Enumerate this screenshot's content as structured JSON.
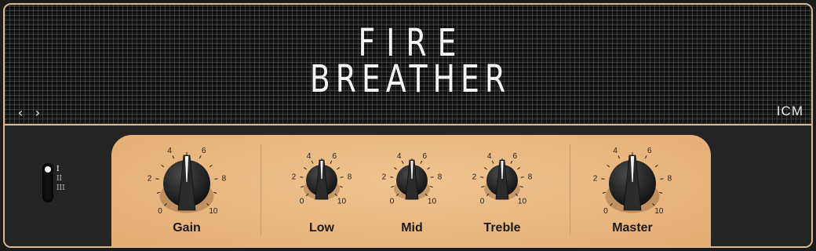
{
  "header": {
    "title_line1": "FIRE",
    "title_line2": "BREATHER",
    "nav_prev": "‹",
    "nav_next": "›",
    "brand": "ICM"
  },
  "switch": {
    "positions": [
      "I",
      "II",
      "III"
    ],
    "selected": "I"
  },
  "knobs": [
    {
      "label": "Gain",
      "value": 5,
      "scale": [
        "0",
        "2",
        "4",
        "6",
        "8",
        "10"
      ]
    },
    {
      "label": "Low",
      "value": 5,
      "scale": [
        "0",
        "2",
        "4",
        "6",
        "8",
        "10"
      ]
    },
    {
      "label": "Mid",
      "value": 5,
      "scale": [
        "0",
        "2",
        "4",
        "6",
        "8",
        "10"
      ]
    },
    {
      "label": "Treble",
      "value": 5,
      "scale": [
        "0",
        "2",
        "4",
        "6",
        "8",
        "10"
      ]
    },
    {
      "label": "Master",
      "value": 5,
      "scale": [
        "0",
        "2",
        "4",
        "6",
        "8",
        "10"
      ]
    }
  ],
  "colors": {
    "accent": "#d9b98d",
    "panel": "#ecba84",
    "knob": "#1f1f1f"
  }
}
